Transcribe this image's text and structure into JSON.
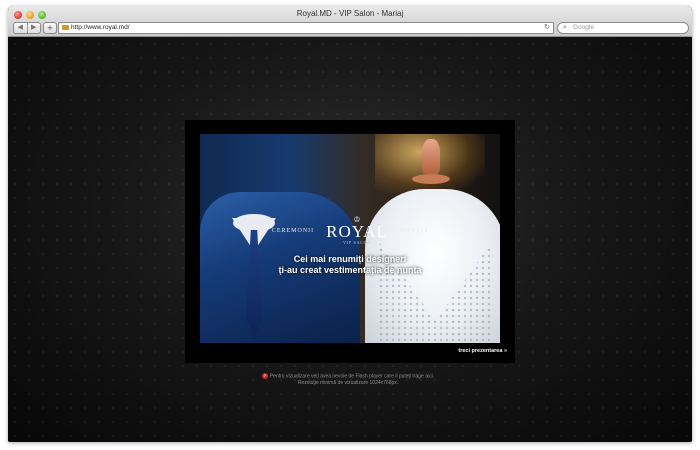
{
  "window": {
    "title": "Royal.MD - VIP Salon - Mariaj"
  },
  "toolbar": {
    "back_symbol": "◀",
    "forward_symbol": "▶",
    "add_symbol": "+",
    "url": "http://www.royal.md/",
    "reload_symbol": "↻",
    "search_placeholder": "Google",
    "search_symbol": "⌕"
  },
  "presentation": {
    "left_label": "CEREMONII",
    "logo_crown": "♔",
    "logo_name": "ROYAL",
    "logo_sub": "VIP SALON",
    "right_label": "MARIAJ",
    "tagline_line1": "Cei mai renumiți designeri",
    "tagline_line2": "ți-au creat vestimentația de nunta",
    "skip_label": "treci prezentarea »"
  },
  "notice": {
    "icon_symbol": "?",
    "line1": "Pentru vizualizare veți avea nevoie de Flash player care il puteți tragе aici.",
    "line2": "Rezoluție minimă de vizualizare 1024x768px."
  },
  "colors": {
    "page_background": "#000000",
    "accent_red": "#cf2a2a"
  }
}
